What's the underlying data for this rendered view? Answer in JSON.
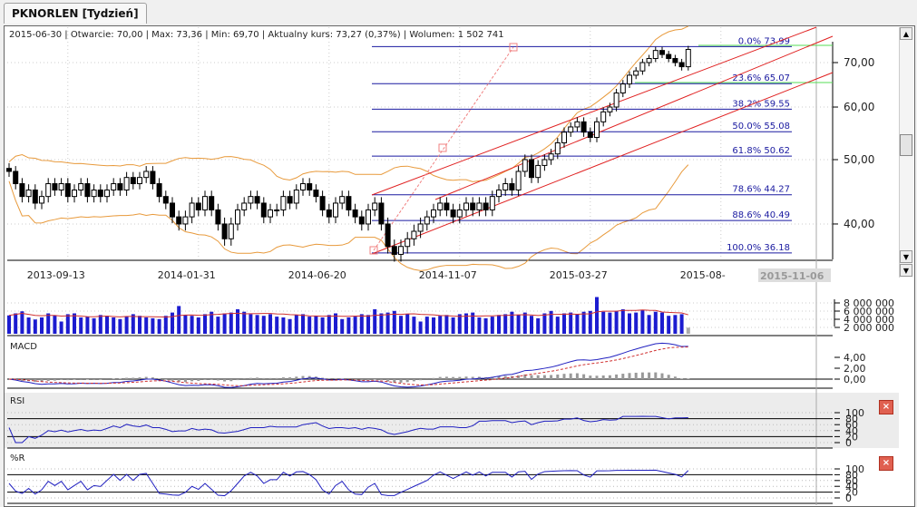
{
  "tab": {
    "title": "PKNORLEN [Tydzień]"
  },
  "info": "2015-06-30 | Otwarcie: 70,00 | Max: 73,36 | Min: 69,70 | Aktualny kurs: 73,27 (0,37%)  | Wolumen: 1 502 741",
  "panels": {
    "macd": "MACD",
    "rsi": "RSI",
    "wr": "%R"
  },
  "chart_data": {
    "type": "candlestick",
    "price_ticks": [
      "70,00",
      "60,00",
      "50,00",
      "40,00"
    ],
    "price_tick_values": [
      70,
      60,
      50,
      40
    ],
    "date_ticks": [
      "2013-09-13",
      "2014-01-31",
      "2014-06-20",
      "2014-11-07",
      "2015-03-27",
      "2015-08-"
    ],
    "date_tick_weeks": [
      9,
      29,
      49,
      69,
      89,
      109
    ],
    "cursor_date": "2015-11-06",
    "closes": [
      48,
      46,
      44,
      45,
      43,
      44,
      46,
      45,
      46,
      44,
      45,
      46,
      44,
      45,
      44,
      45,
      46,
      45,
      47,
      46,
      47,
      48,
      46,
      44,
      43,
      41,
      40,
      41,
      43,
      42,
      44,
      42,
      40,
      38,
      40,
      42,
      43,
      44,
      43,
      41,
      42,
      42,
      44,
      43,
      45,
      46,
      45,
      44,
      42,
      41,
      43,
      44,
      42,
      41,
      40,
      42,
      43,
      40,
      37,
      36,
      37,
      38,
      39,
      40,
      41,
      42,
      43,
      42,
      41,
      42,
      43,
      42,
      43,
      42,
      44,
      45,
      46,
      45,
      48,
      50,
      47,
      49,
      50,
      51,
      53,
      55,
      56,
      57,
      55,
      54,
      57,
      59,
      60,
      63,
      65,
      67,
      68,
      70,
      71,
      73,
      72,
      71,
      70,
      69,
      73.27
    ],
    "volumes_mln": [
      4.5,
      5,
      5.5,
      4,
      3.5,
      4,
      5,
      4.5,
      3,
      4.8,
      5,
      4,
      4.2,
      3.8,
      4.6,
      4.4,
      4,
      3.6,
      4.2,
      4.8,
      4.4,
      4,
      3.8,
      3.6,
      4.4,
      5.2,
      6.8,
      4.6,
      4.4,
      4,
      4.8,
      5.4,
      4.2,
      5,
      5.2,
      6,
      5.4,
      4.8,
      4.6,
      4.4,
      4.8,
      4.2,
      4,
      3.6,
      4.6,
      4.8,
      4.2,
      4.4,
      4,
      4.6,
      5,
      3.6,
      4,
      4.2,
      4.8,
      4.6,
      6,
      5,
      5.2,
      5.6,
      4.4,
      4.8,
      4.2,
      3,
      4.2,
      4,
      4.4,
      4.6,
      4,
      4.8,
      5,
      5.2,
      4,
      3.8,
      4.2,
      4.6,
      4.8,
      5.4,
      4.6,
      5.2,
      4.4,
      3.8,
      5,
      5.6,
      4.2,
      5,
      5.2,
      4.8,
      5.4,
      5.6,
      9,
      5.4,
      5.2,
      5.6,
      6,
      5,
      5.2,
      5.8,
      4.6,
      5.4,
      5.2,
      4.4,
      4.6,
      4.8,
      1.5
    ],
    "volume_ticks": [
      "8 000 000",
      "6 000 000",
      "4 000 000",
      "2 000 000"
    ],
    "macd_ticks": [
      "4,00",
      "2,00",
      "0,00"
    ],
    "osc_ticks": [
      "100",
      "80",
      "60",
      "40",
      "20",
      "0"
    ],
    "fibonacci": [
      {
        "label": "0.0% 73.99",
        "v": 73.99
      },
      {
        "label": "23.6% 65.07",
        "v": 65.07
      },
      {
        "label": "38.2% 59.55",
        "v": 59.55
      },
      {
        "label": "50.0% 55.08",
        "v": 55.08
      },
      {
        "label": "61.8% 50.62",
        "v": 50.62
      },
      {
        "label": "78.6% 44.27",
        "v": 44.27
      },
      {
        "label": "88.6% 40.49",
        "v": 40.49
      },
      {
        "label": "100.0% 36.18",
        "v": 36.18
      }
    ]
  }
}
